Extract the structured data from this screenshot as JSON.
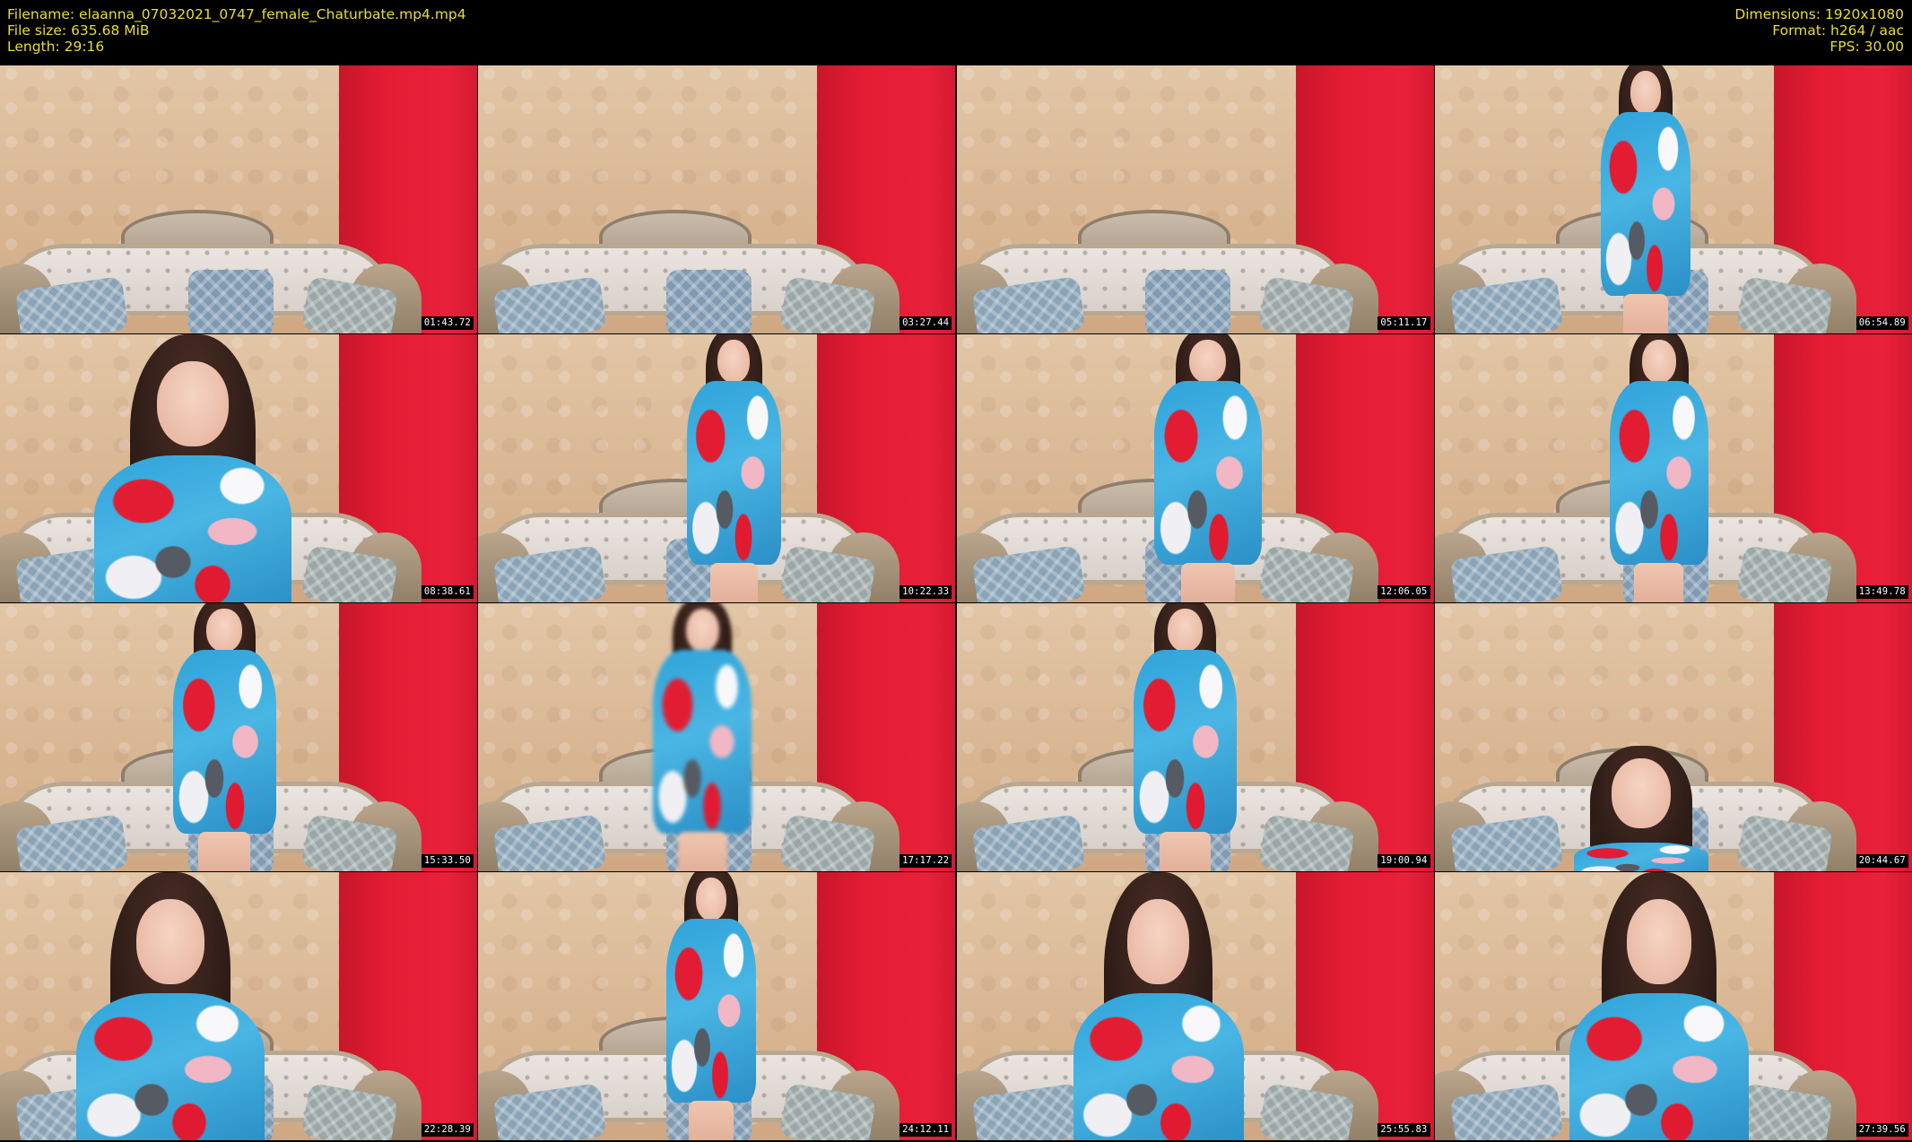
{
  "header": {
    "filename": "Filename: elaanna_07032021_0747_female_Chaturbate.mp4.mp4",
    "file_size": "File size: 635.68 MiB",
    "length": "Length: 29:16",
    "dimensions": "Dimensions: 1920x1080",
    "format": "Format: h264 / aac",
    "fps": "FPS: 30.00"
  },
  "colors": {
    "header_text": "#e8dc3c",
    "background": "#000000",
    "wall": "#d9b693",
    "red_panel": "#e41c34",
    "dress_blue": "#2fa3d9"
  },
  "thumbnails": [
    {
      "time": "01:43.72",
      "person": "none"
    },
    {
      "time": "03:27.44",
      "person": "none"
    },
    {
      "time": "05:11.17",
      "person": "none"
    },
    {
      "time": "06:54.89",
      "person": "standing"
    },
    {
      "time": "08:38.61",
      "person": "closeup"
    },
    {
      "time": "10:22.33",
      "person": "standing"
    },
    {
      "time": "12:06.05",
      "person": "standing"
    },
    {
      "time": "13:49.78",
      "person": "standing"
    },
    {
      "time": "15:33.50",
      "person": "standing"
    },
    {
      "time": "17:17.22",
      "person": "standing"
    },
    {
      "time": "19:00.94",
      "person": "standing"
    },
    {
      "time": "20:44.67",
      "person": "low"
    },
    {
      "time": "22:28.39",
      "person": "closeup"
    },
    {
      "time": "24:12.11",
      "person": "standing"
    },
    {
      "time": "25:55.83",
      "person": "closeup"
    },
    {
      "time": "27:39.56",
      "person": "closeup"
    }
  ]
}
